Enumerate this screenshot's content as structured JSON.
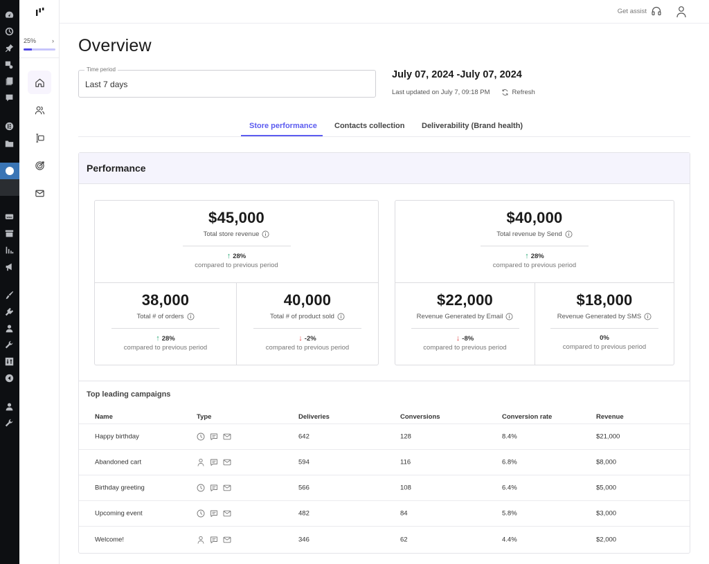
{
  "wp_admin_bar": {
    "icons": [
      "dashboard-icon",
      "history-icon",
      "pin-icon",
      "media-icon",
      "pages-icon",
      "comments-icon",
      "elementor-icon",
      "folder-icon",
      "active-plugin-icon",
      "woo-icon",
      "archive-icon",
      "analytics-icon",
      "marketing-icon",
      "appearance-icon",
      "plugins-icon",
      "users-icon",
      "tools-icon",
      "settings-icon",
      "collapse-icon",
      "user-icon",
      "wrench-icon"
    ]
  },
  "side_nav": {
    "progress": {
      "label": "25%",
      "value_percent": 25
    },
    "items": [
      {
        "name": "home",
        "icon": "home-icon",
        "active": true
      },
      {
        "name": "contacts",
        "icon": "users-icon",
        "active": false
      },
      {
        "name": "forms",
        "icon": "form-icon",
        "active": false
      },
      {
        "name": "campaigns",
        "icon": "target-icon",
        "active": false
      },
      {
        "name": "email",
        "icon": "mail-icon",
        "active": false
      }
    ]
  },
  "topbar": {
    "assist_label": "Get assist"
  },
  "page": {
    "title": "Overview",
    "time_period": {
      "legend": "Time period",
      "value": "Last 7 days"
    },
    "date_range": "July 07, 2024 -July 07, 2024",
    "last_updated": "Last updated on July 7, 09:18 PM",
    "refresh_label": "Refresh"
  },
  "tabs": [
    {
      "label": "Store performance",
      "active": true
    },
    {
      "label": "Contacts collection",
      "active": false
    },
    {
      "label": "Deliverability (Brand health)",
      "active": false
    }
  ],
  "performance": {
    "title": "Performance",
    "compare_text": "compared to previous period",
    "store": {
      "total": {
        "value": "$45,000",
        "label": "Total store revenue",
        "change": "28%",
        "direction": "up"
      },
      "left": {
        "value": "38,000",
        "label": "Total # of orders",
        "change": "28%",
        "direction": "up"
      },
      "right": {
        "value": "40,000",
        "label": "Total # of product sold",
        "change": "-2%",
        "direction": "down"
      }
    },
    "send": {
      "total": {
        "value": "$40,000",
        "label": "Total revenue by Send",
        "change": "28%",
        "direction": "up"
      },
      "left": {
        "value": "$22,000",
        "label": "Revenue Generated by Email",
        "change": "-8%",
        "direction": "down"
      },
      "right": {
        "value": "$18,000",
        "label": "Revenue Generated by SMS",
        "change": "0%",
        "direction": "none"
      }
    }
  },
  "campaigns": {
    "title": "Top leading campaigns",
    "columns": [
      "Name",
      "Type",
      "Deliveries",
      "Conversions",
      "Conversion rate",
      "Revenue"
    ],
    "rows": [
      {
        "name": "Happy birthday",
        "types": [
          "clock-icon",
          "sms-icon",
          "mail-icon"
        ],
        "deliveries": "642",
        "conversions": "128",
        "rate": "8.4%",
        "revenue": "$21,000"
      },
      {
        "name": "Abandoned cart",
        "types": [
          "person-icon",
          "sms-icon",
          "mail-icon"
        ],
        "deliveries": "594",
        "conversions": "116",
        "rate": "6.8%",
        "revenue": "$8,000"
      },
      {
        "name": "Birthday greeting",
        "types": [
          "clock-icon",
          "sms-icon",
          "mail-icon"
        ],
        "deliveries": "566",
        "conversions": "108",
        "rate": "6.4%",
        "revenue": "$5,000"
      },
      {
        "name": "Upcoming event",
        "types": [
          "clock-icon",
          "sms-icon",
          "mail-icon"
        ],
        "deliveries": "482",
        "conversions": "84",
        "rate": "5.8%",
        "revenue": "$3,000"
      },
      {
        "name": "Welcome!",
        "types": [
          "person-icon",
          "sms-icon",
          "mail-icon"
        ],
        "deliveries": "346",
        "conversions": "62",
        "rate": "4.4%",
        "revenue": "$2,000"
      }
    ]
  },
  "colors": {
    "accent": "#5b5bf0",
    "up": "#2aa876",
    "down": "#e04545",
    "wp_active": "#3a75b5",
    "header_bg": "#f5f4fd"
  }
}
